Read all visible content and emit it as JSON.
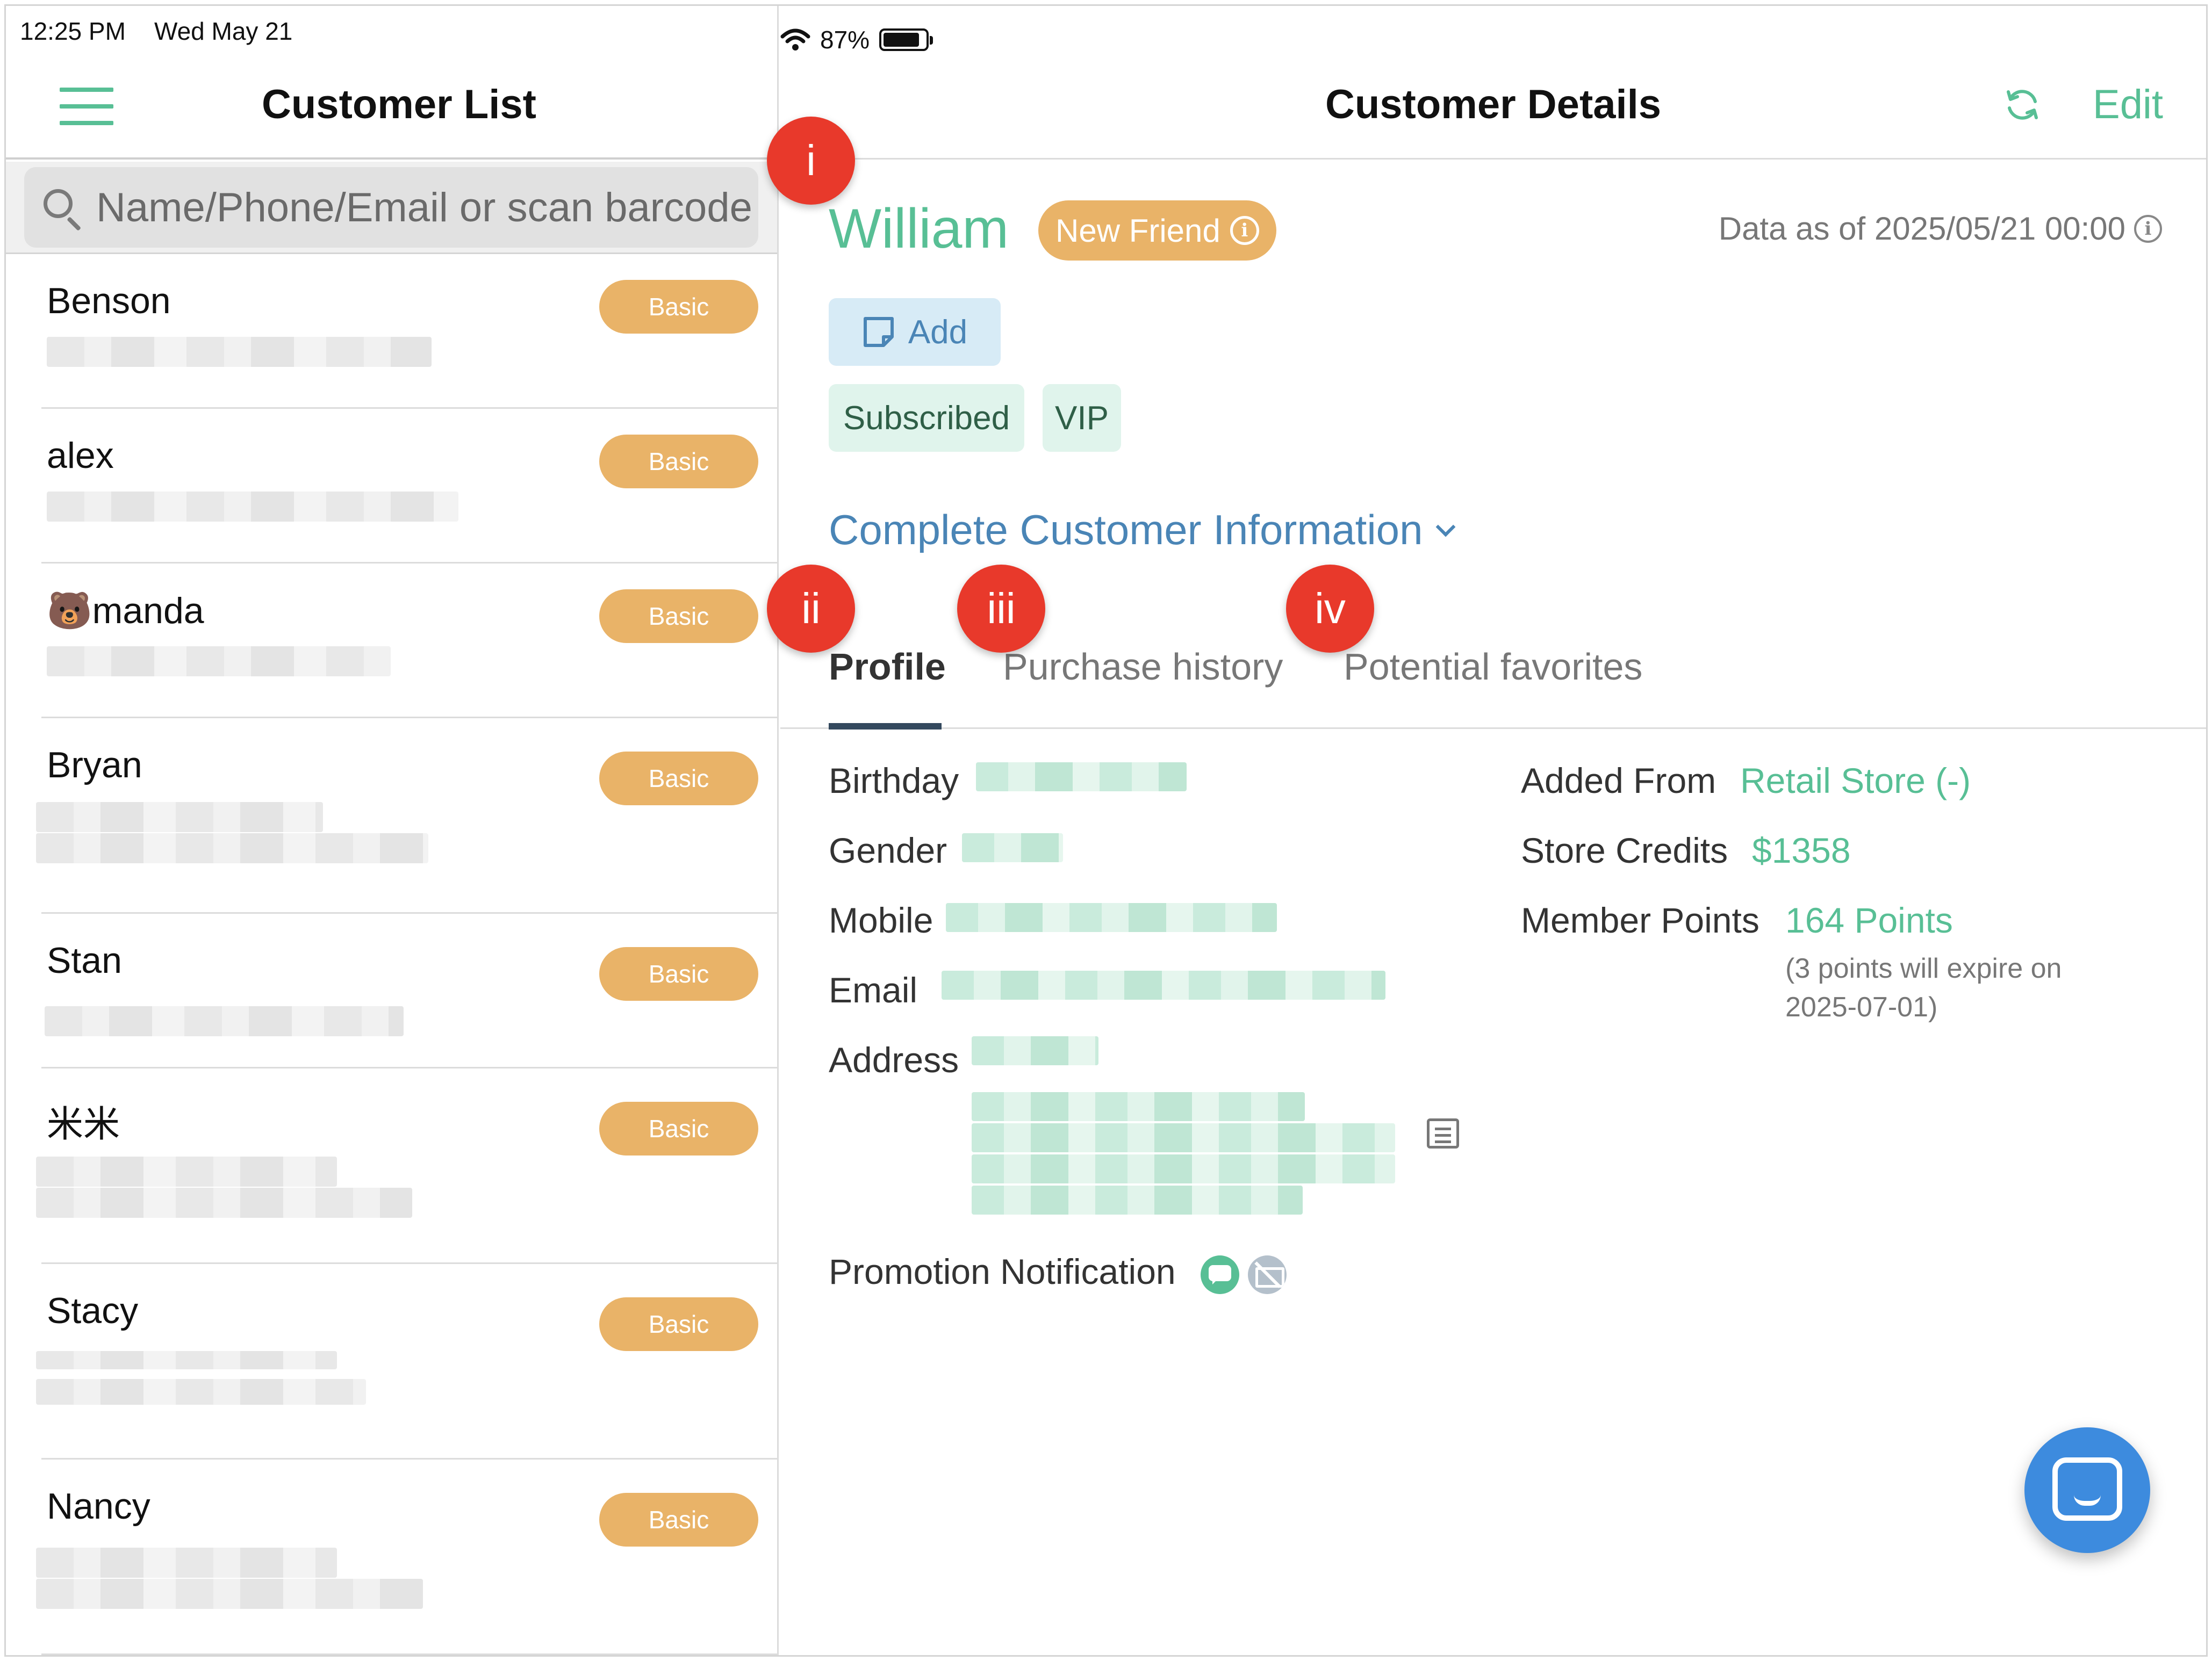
{
  "status_bar": {
    "time": "12:25 PM",
    "date": "Wed May 21",
    "battery": "87%",
    "battery_level": 0.87
  },
  "customer_list": {
    "title": "Customer List",
    "search_placeholder": "Name/Phone/Email or scan barcode",
    "customers": [
      {
        "name": "Benson",
        "badge": "Basic"
      },
      {
        "name": "alex",
        "badge": "Basic"
      },
      {
        "name": "🐻manda",
        "badge": "Basic"
      },
      {
        "name": "Bryan",
        "badge": "Basic"
      },
      {
        "name": "Stan",
        "badge": "Basic"
      },
      {
        "name": "米米",
        "badge": "Basic"
      },
      {
        "name": "Stacy",
        "badge": "Basic"
      },
      {
        "name": "Nancy",
        "badge": "Basic"
      }
    ]
  },
  "customer_details": {
    "title": "Customer Details",
    "edit_label": "Edit",
    "name": "William",
    "friend_badge": "New Friend",
    "data_as_of": "Data as of 2025/05/21 00:00",
    "add_label": "Add",
    "tags": [
      "Subscribed",
      "VIP"
    ],
    "complete_info_label": "Complete Customer Information",
    "tabs": [
      "Profile",
      "Purchase history",
      "Potential favorites"
    ],
    "active_tab": "Profile",
    "profile": {
      "birthday_label": "Birthday",
      "gender_label": "Gender",
      "mobile_label": "Mobile",
      "email_label": "Email",
      "address_label": "Address",
      "promotion_label": "Promotion Notification",
      "added_from_label": "Added From",
      "added_from_value": "Retail Store (-)",
      "store_credits_label": "Store Credits",
      "store_credits_value": "$1358",
      "member_points_label": "Member Points",
      "member_points_value": "164 Points",
      "points_note_line1": "(3 points will expire on",
      "points_note_line2": "2025-07-01)"
    }
  },
  "annotations": [
    "i",
    "ii",
    "iii",
    "iv"
  ],
  "colors": {
    "accent_green": "#58bf95",
    "badge_orange": "#e9b368",
    "link_blue": "#4a85b6",
    "marker_red": "#e8392b",
    "fab_blue": "#3d8bde"
  },
  "icons": [
    "hamburger-icon",
    "search-icon",
    "refresh-icon",
    "info-icon",
    "note-icon",
    "chevron-down-icon",
    "copy-icon",
    "chat-notification-icon",
    "email-disabled-icon",
    "support-chat-icon",
    "wifi-icon",
    "battery-icon"
  ]
}
